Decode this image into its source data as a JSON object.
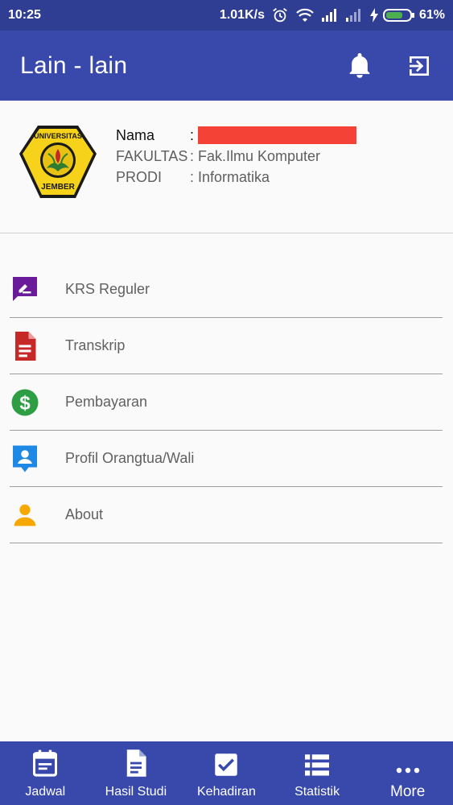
{
  "status_bar": {
    "time": "10:25",
    "speed": "1.01K/s",
    "battery": "61%"
  },
  "app_bar": {
    "title": "Lain - lain",
    "color": "#3949ab"
  },
  "profile": {
    "logo_text_top": "UNIVERSITAS",
    "logo_text_bottom": "JEMBER",
    "name_label": "Nama",
    "name_sep": ":",
    "fakultas_label": "FAKULTAS",
    "fakultas_sep": ":",
    "fakultas_value": "Fak.Ilmu Komputer",
    "prodi_label": "PRODI",
    "prodi_sep": ":",
    "prodi_value": "Informatika"
  },
  "menu": {
    "items": [
      {
        "label": "KRS Reguler",
        "icon": "edit-note-icon",
        "color": "#6a1b9a"
      },
      {
        "label": "Transkrip",
        "icon": "document-icon",
        "color": "#c62828"
      },
      {
        "label": "Pembayaran",
        "icon": "dollar-icon",
        "color": "#2e9e44"
      },
      {
        "label": "Profil Orangtua/Wali",
        "icon": "contact-icon",
        "color": "#1e88e5"
      },
      {
        "label": "About",
        "icon": "person-icon",
        "color": "#f6a800"
      }
    ]
  },
  "bottom_nav": {
    "items": [
      {
        "label": "Jadwal",
        "icon": "calendar-icon"
      },
      {
        "label": "Hasil Studi",
        "icon": "document-icon"
      },
      {
        "label": "Kehadiran",
        "icon": "checkbox-icon"
      },
      {
        "label": "Statistik",
        "icon": "list-icon"
      },
      {
        "label": "More",
        "icon": "more-icon"
      }
    ]
  }
}
